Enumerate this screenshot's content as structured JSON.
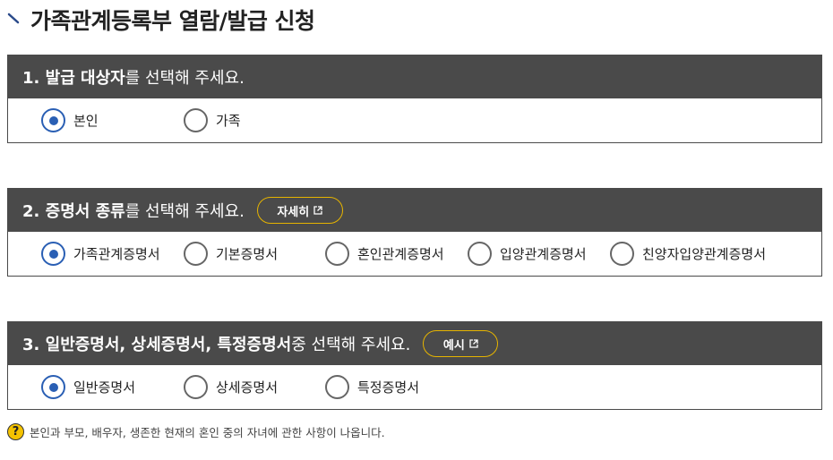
{
  "page_title": "가족관계등록부 열람/발급 신청",
  "sections": [
    {
      "title_strong": "1. 발급 대상자",
      "title_rest": "를 선택해 주세요.",
      "button": null,
      "options": [
        {
          "label": "본인",
          "selected": true
        },
        {
          "label": "가족",
          "selected": false
        }
      ]
    },
    {
      "title_strong": "2. 증명서 종류",
      "title_rest": "를 선택해 주세요.",
      "button": "자세히",
      "options": [
        {
          "label": "가족관계증명서",
          "selected": true
        },
        {
          "label": "기본증명서",
          "selected": false
        },
        {
          "label": "혼인관계증명서",
          "selected": false
        },
        {
          "label": "입양관계증명서",
          "selected": false
        },
        {
          "label": "친양자입양관계증명서",
          "selected": false
        }
      ]
    },
    {
      "title_strong": "3. 일반증명서, 상세증명서, 특정증명서",
      "title_rest": " 중 선택해 주세요.",
      "button": "예시",
      "options": [
        {
          "label": "일반증명서",
          "selected": true
        },
        {
          "label": "상세증명서",
          "selected": false
        },
        {
          "label": "특정증명서",
          "selected": false
        }
      ]
    }
  ],
  "note": {
    "icon": "question-icon",
    "text": "본인과 부모, 배우자, 생존한 현재의 혼인 중의 자녀에 관한 사항이 나옵니다."
  },
  "colors": {
    "header_bg": "#4a4a4a",
    "radio_selected": "#2a5fb4",
    "pill_border": "#e6b400",
    "note_icon": "#f4c200"
  }
}
